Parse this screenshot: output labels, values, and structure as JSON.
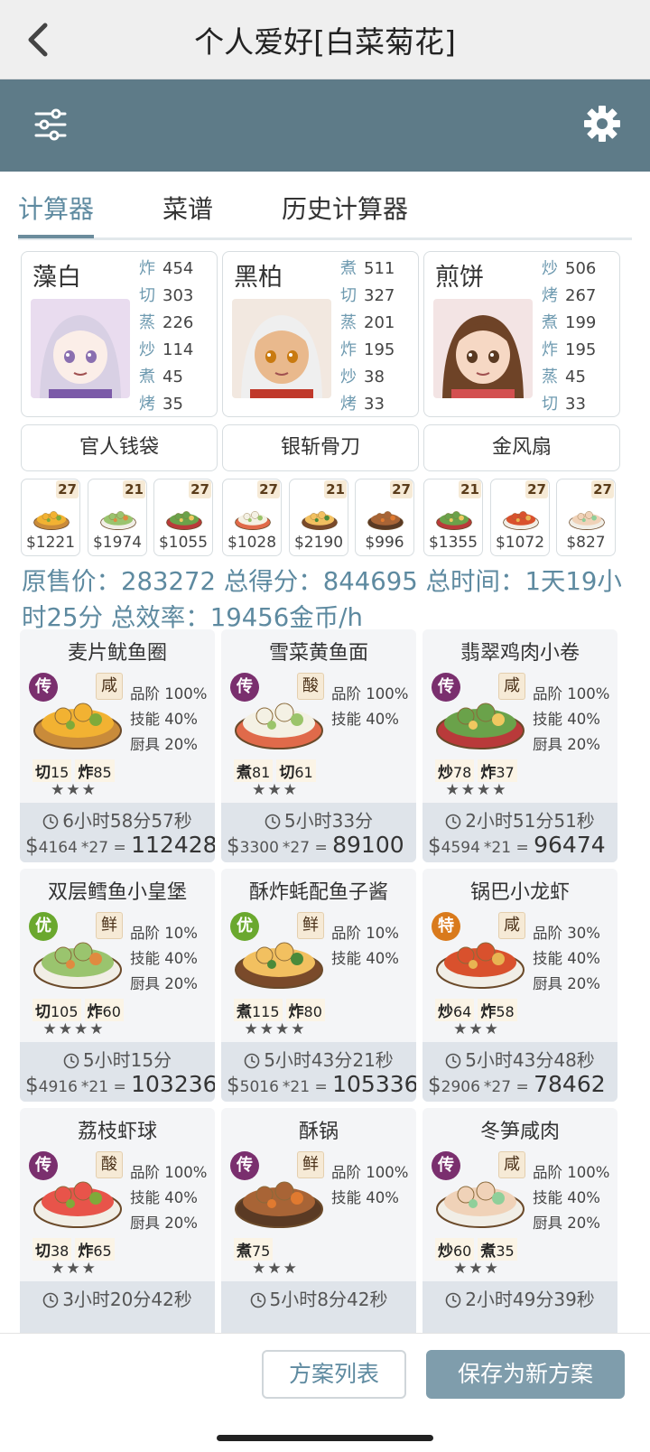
{
  "header": {
    "title": "个人爱好[白菜菊花]"
  },
  "tabs": [
    {
      "label": "计算器",
      "active": true
    },
    {
      "label": "菜谱",
      "active": false
    },
    {
      "label": "历史计算器",
      "active": false
    }
  ],
  "chefs": [
    {
      "name": "藻白",
      "skills": [
        [
          "炸",
          "454"
        ],
        [
          "切",
          "303"
        ],
        [
          "蒸",
          "226"
        ],
        [
          "炒",
          "114"
        ],
        [
          "煮",
          "45"
        ],
        [
          "烤",
          "35"
        ]
      ]
    },
    {
      "name": "黑柏",
      "skills": [
        [
          "煮",
          "511"
        ],
        [
          "切",
          "327"
        ],
        [
          "蒸",
          "201"
        ],
        [
          "炸",
          "195"
        ],
        [
          "炒",
          "38"
        ],
        [
          "烤",
          "33"
        ]
      ]
    },
    {
      "name": "煎饼",
      "skills": [
        [
          "炒",
          "506"
        ],
        [
          "烤",
          "267"
        ],
        [
          "煮",
          "199"
        ],
        [
          "炸",
          "195"
        ],
        [
          "蒸",
          "45"
        ],
        [
          "切",
          "33"
        ]
      ]
    }
  ],
  "equipment": [
    "官人钱袋",
    "银斩骨刀",
    "金风扇"
  ],
  "mini_dishes": [
    {
      "qty": "27",
      "price": "$1221"
    },
    {
      "qty": "21",
      "price": "$1974"
    },
    {
      "qty": "27",
      "price": "$1055"
    },
    {
      "qty": "27",
      "price": "$1028"
    },
    {
      "qty": "21",
      "price": "$2190"
    },
    {
      "qty": "27",
      "price": "$996"
    },
    {
      "qty": "21",
      "price": "$1355"
    },
    {
      "qty": "27",
      "price": "$1072"
    },
    {
      "qty": "27",
      "price": "$827"
    }
  ],
  "summary": "原售价：283272 总得分：844695 总时间：1天19小时25分 总效率：19456金币/h",
  "dishes": [
    {
      "name": "麦片鱿鱼圈",
      "rank": "传",
      "taste": "咸",
      "bonus": [
        "品阶 100%",
        "技能 40%",
        "厨具 20%"
      ],
      "req": [
        [
          "切",
          "15"
        ],
        [
          "炸",
          "85"
        ]
      ],
      "stars": "★★★",
      "time": "6小时58分57秒",
      "price": "4164",
      "mult": "*27",
      "total": "112428"
    },
    {
      "name": "雪菜黄鱼面",
      "rank": "传",
      "taste": "酸",
      "bonus": [
        "品阶 100%",
        "技能 40%"
      ],
      "req": [
        [
          "煮",
          "81"
        ],
        [
          "切",
          "61"
        ]
      ],
      "stars": "★★★",
      "time": "5小时33分",
      "price": "3300",
      "mult": "*27",
      "total": "89100"
    },
    {
      "name": "翡翠鸡肉小卷",
      "rank": "传",
      "taste": "咸",
      "bonus": [
        "品阶 100%",
        "技能 40%",
        "厨具 20%"
      ],
      "req": [
        [
          "炒",
          "78"
        ],
        [
          "炸",
          "37"
        ]
      ],
      "stars": "★★★★",
      "time": "2小时51分51秒",
      "price": "4594",
      "mult": "*21",
      "total": "96474"
    },
    {
      "name": "双层鳕鱼小皇堡",
      "rank": "优",
      "taste": "鲜",
      "bonus": [
        "品阶 10%",
        "技能 40%",
        "厨具 20%"
      ],
      "req": [
        [
          "切",
          "105"
        ],
        [
          "炸",
          "60"
        ]
      ],
      "stars": "★★★★",
      "time": "5小时15分",
      "price": "4916",
      "mult": "*21",
      "total": "103236"
    },
    {
      "name": "酥炸蚝配鱼子酱",
      "rank": "优",
      "taste": "鲜",
      "bonus": [
        "品阶 10%",
        "技能 40%"
      ],
      "req": [
        [
          "煮",
          "115"
        ],
        [
          "炸",
          "80"
        ]
      ],
      "stars": "★★★★",
      "time": "5小时43分21秒",
      "price": "5016",
      "mult": "*21",
      "total": "105336"
    },
    {
      "name": "锅巴小龙虾",
      "rank": "特",
      "taste": "咸",
      "bonus": [
        "品阶 30%",
        "技能 40%",
        "厨具 20%"
      ],
      "req": [
        [
          "炒",
          "64"
        ],
        [
          "炸",
          "58"
        ]
      ],
      "stars": "★★★",
      "time": "5小时43分48秒",
      "price": "2906",
      "mult": "*27",
      "total": "78462"
    },
    {
      "name": "荔枝虾球",
      "rank": "传",
      "taste": "酸",
      "bonus": [
        "品阶 100%",
        "技能 40%",
        "厨具 20%"
      ],
      "req": [
        [
          "切",
          "38"
        ],
        [
          "炸",
          "65"
        ]
      ],
      "stars": "★★★",
      "time": "3小时20分42秒",
      "price": "",
      "mult": "",
      "total": ""
    },
    {
      "name": "酥锅",
      "rank": "传",
      "taste": "鲜",
      "bonus": [
        "品阶 100%",
        "技能 40%"
      ],
      "req": [
        [
          "煮",
          "75"
        ]
      ],
      "stars": "★★★",
      "time": "5小时8分42秒",
      "price": "",
      "mult": "",
      "total": ""
    },
    {
      "name": "冬笋咸肉",
      "rank": "传",
      "taste": "咸",
      "bonus": [
        "品阶 100%",
        "技能 40%",
        "厨具 20%"
      ],
      "req": [
        [
          "炒",
          "60"
        ],
        [
          "煮",
          "35"
        ]
      ],
      "stars": "★★★",
      "time": "2小时49分39秒",
      "price": "",
      "mult": "",
      "total": ""
    }
  ],
  "actions": {
    "list_label": "方案列表",
    "save_label": "保存为新方案"
  },
  "colors": {
    "toolbar": "#5e7b88",
    "accent": "#5e8aa0",
    "rank_legend": "#7a2f6e",
    "rank_good": "#6aa82e",
    "rank_special": "#d97a1c"
  }
}
